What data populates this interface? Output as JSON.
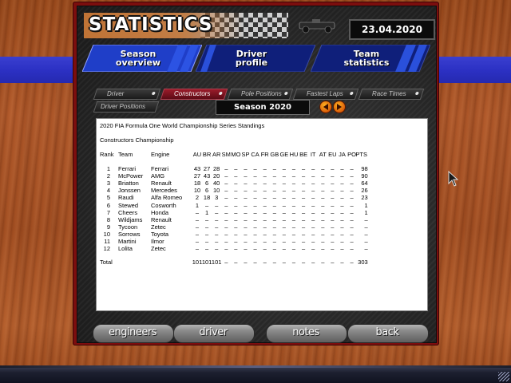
{
  "app": {
    "title": "STATISTICS",
    "date": "23.04.2020"
  },
  "colors": {
    "panel_border": "#7c0e0e",
    "blue_band": "#2c31c4",
    "tab_blue": "#1f3ec8",
    "active_subtab": "#9b1b2a"
  },
  "main_tabs": [
    {
      "line1": "Season",
      "line2": "overview"
    },
    {
      "line1": "Driver",
      "line2": "profile"
    },
    {
      "line1": "Team",
      "line2": "statistics"
    }
  ],
  "sub_tabs": {
    "driver": "Driver",
    "constructors": "Constructors",
    "pole_positions": "Pole Positions",
    "fastest_laps": "Fastest Laps",
    "race_times": "Race Times",
    "driver_positions": "Driver Positions"
  },
  "season_label": "Season 2020",
  "standings": {
    "heading": "2020 FIA Formula One World Championship Series Standings",
    "subheading": "Constructors Championship",
    "columns": [
      "Rank",
      "Team",
      "Engine",
      "AU",
      "BR",
      "AR",
      "SM",
      "MO",
      "SP",
      "CA",
      "FR",
      "GB",
      "GE",
      "HU",
      "BE",
      "IT",
      "AT",
      "EU",
      "JA",
      "PO",
      "PTS"
    ],
    "rows": [
      {
        "rank": "1",
        "team": "Ferrari",
        "engine": "Ferrari",
        "res": [
          "43",
          "27",
          "28",
          "–",
          "–",
          "–",
          "–",
          "–",
          "–",
          "–",
          "–",
          "–",
          "–",
          "–",
          "–",
          "–",
          "–"
        ],
        "pts": "98"
      },
      {
        "rank": "2",
        "team": "McPower",
        "engine": "AMG",
        "res": [
          "27",
          "43",
          "20",
          "–",
          "–",
          "–",
          "–",
          "–",
          "–",
          "–",
          "–",
          "–",
          "–",
          "–",
          "–",
          "–",
          "–"
        ],
        "pts": "90"
      },
      {
        "rank": "3",
        "team": "Briatton",
        "engine": "Renault",
        "res": [
          "18",
          "6",
          "40",
          "–",
          "–",
          "–",
          "–",
          "–",
          "–",
          "–",
          "–",
          "–",
          "–",
          "–",
          "–",
          "–",
          "–"
        ],
        "pts": "64"
      },
      {
        "rank": "4",
        "team": "Jonssen",
        "engine": "Mercedes",
        "res": [
          "10",
          "6",
          "10",
          "–",
          "–",
          "–",
          "–",
          "–",
          "–",
          "–",
          "–",
          "–",
          "–",
          "–",
          "–",
          "–",
          "–"
        ],
        "pts": "26"
      },
      {
        "rank": "5",
        "team": "Raudi",
        "engine": "Alfa Romeo",
        "res": [
          "2",
          "18",
          "3",
          "–",
          "–",
          "–",
          "–",
          "–",
          "–",
          "–",
          "–",
          "–",
          "–",
          "–",
          "–",
          "–",
          "–"
        ],
        "pts": "23"
      },
      {
        "rank": "6",
        "team": "Stewed",
        "engine": "Cosworth",
        "res": [
          "1",
          "–",
          "–",
          "–",
          "–",
          "–",
          "–",
          "–",
          "–",
          "–",
          "–",
          "–",
          "–",
          "–",
          "–",
          "–",
          "–"
        ],
        "pts": "1"
      },
      {
        "rank": "7",
        "team": "Cheers",
        "engine": "Honda",
        "res": [
          "–",
          "1",
          "–",
          "–",
          "–",
          "–",
          "–",
          "–",
          "–",
          "–",
          "–",
          "–",
          "–",
          "–",
          "–",
          "–",
          "–"
        ],
        "pts": "1"
      },
      {
        "rank": "8",
        "team": "Wildjams",
        "engine": "Renault",
        "res": [
          "–",
          "–",
          "–",
          "–",
          "–",
          "–",
          "–",
          "–",
          "–",
          "–",
          "–",
          "–",
          "–",
          "–",
          "–",
          "–",
          "–"
        ],
        "pts": "–"
      },
      {
        "rank": "9",
        "team": "Tycoon",
        "engine": "Zetec",
        "res": [
          "–",
          "–",
          "–",
          "–",
          "–",
          "–",
          "–",
          "–",
          "–",
          "–",
          "–",
          "–",
          "–",
          "–",
          "–",
          "–",
          "–"
        ],
        "pts": "–"
      },
      {
        "rank": "10",
        "team": "Sorrows",
        "engine": "Toyota",
        "res": [
          "–",
          "–",
          "–",
          "–",
          "–",
          "–",
          "–",
          "–",
          "–",
          "–",
          "–",
          "–",
          "–",
          "–",
          "–",
          "–",
          "–"
        ],
        "pts": "–"
      },
      {
        "rank": "11",
        "team": "Martini",
        "engine": "Ilmor",
        "res": [
          "–",
          "–",
          "–",
          "–",
          "–",
          "–",
          "–",
          "–",
          "–",
          "–",
          "–",
          "–",
          "–",
          "–",
          "–",
          "–",
          "–"
        ],
        "pts": "–"
      },
      {
        "rank": "12",
        "team": "Lolita",
        "engine": "Zetec",
        "res": [
          "–",
          "–",
          "–",
          "–",
          "–",
          "–",
          "–",
          "–",
          "–",
          "–",
          "–",
          "–",
          "–",
          "–",
          "–",
          "–",
          "–"
        ],
        "pts": "–"
      }
    ],
    "total": {
      "label": "Total",
      "res": [
        "101",
        "101",
        "101",
        "–",
        "–",
        "–",
        "–",
        "–",
        "–",
        "–",
        "–",
        "–",
        "–",
        "–",
        "–",
        "–",
        "–"
      ],
      "pts": "303"
    }
  },
  "bottom_buttons": {
    "engineers": "engineers",
    "driver": "driver",
    "notes": "notes",
    "back": "back"
  }
}
